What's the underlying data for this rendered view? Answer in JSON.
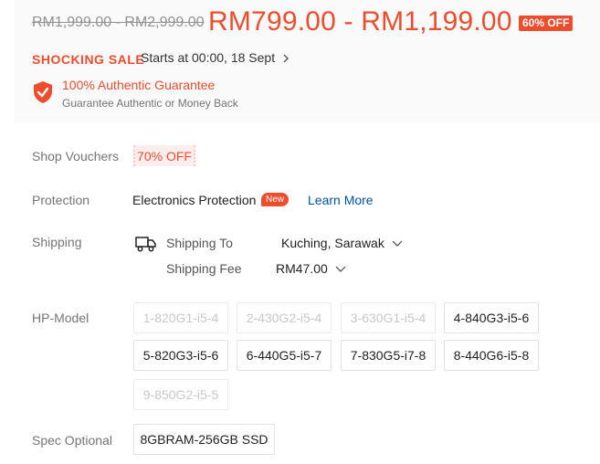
{
  "price": {
    "original": "RM1,999.00 - RM2,999.00",
    "sale": "RM799.00 - RM1,199.00",
    "discount_badge": "60% OFF"
  },
  "flash_sale": {
    "label": "SHOCKING SALE",
    "time": "Starts at 00:00, 18 Sept",
    "chevron_icon": "chevron-right-icon"
  },
  "guarantee": {
    "icon": "shield-check-icon",
    "title": "100% Authentic Guarantee",
    "subtitle": "Guarantee Authentic or Money Back"
  },
  "vouchers": {
    "label": "Shop Vouchers",
    "tag": "70% OFF"
  },
  "protection": {
    "label": "Protection",
    "name": "Electronics Protection",
    "badge": "New",
    "link": "Learn More"
  },
  "shipping": {
    "label": "Shipping",
    "icon": "truck-icon",
    "to_label": "Shipping To",
    "to_value": "Kuching, Sarawak",
    "fee_label": "Shipping Fee",
    "fee_value": "RM47.00"
  },
  "hp_model": {
    "label": "HP-Model",
    "options": [
      {
        "label": "1-820G1-i5-4",
        "disabled": true
      },
      {
        "label": "2-430G2-i5-4",
        "disabled": true
      },
      {
        "label": "3-630G1-i5-4",
        "disabled": true
      },
      {
        "label": "4-840G3-i5-6",
        "disabled": false
      },
      {
        "label": "5-820G3-i5-6",
        "disabled": false
      },
      {
        "label": "6-440G5-i5-7",
        "disabled": false
      },
      {
        "label": "7-830G5-i7-8",
        "disabled": false
      },
      {
        "label": "8-440G6-i5-8",
        "disabled": false
      },
      {
        "label": "9-850G2-i5-5",
        "disabled": true
      }
    ]
  },
  "spec": {
    "label": "Spec Optional",
    "options": [
      {
        "label": "8GBRAM-256GB SSD",
        "disabled": false
      }
    ]
  },
  "colors": {
    "accent": "#ee4d2d",
    "link": "#0055aa",
    "muted": "#757575"
  }
}
